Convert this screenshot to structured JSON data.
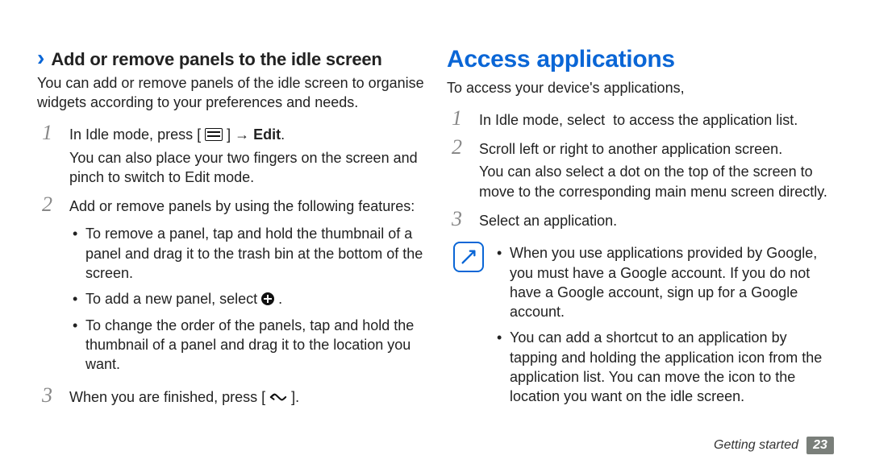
{
  "left": {
    "heading": "Add or remove panels to the idle screen",
    "intro": "You can add or remove panels of the idle screen to organise widgets according to your preferences and needs.",
    "step1_a": "In Idle mode, press [",
    "step1_b": "] → ",
    "step1_bold": "Edit",
    "step1_c": ".",
    "step1_sub": "You can also place your two fingers on the screen and pinch to switch to Edit mode.",
    "step2": "Add or remove panels by using the following features:",
    "b1": "To remove a panel, tap and hold the thumbnail of a panel and drag it to the trash bin at the bottom of the screen.",
    "b2_a": "To add a new panel, select ",
    "b2_b": ".",
    "b3": "To change the order of the panels, tap and hold the thumbnail of a panel and drag it to the location you want.",
    "step3_a": "When you are finished, press [",
    "step3_b": "]."
  },
  "right": {
    "heading": "Access applications",
    "intro": "To access your device's applications,",
    "step1_a": "In Idle mode, select ",
    "step1_b": " to access the application list.",
    "step2": "Scroll left or right to another application screen.",
    "step2_sub": "You can also select a dot on the top of the screen to move to the corresponding main menu screen directly.",
    "step3": "Select an application.",
    "note1": "When you use applications provided by Google, you must have a Google account. If you do not have a Google account, sign up for a Google account.",
    "note2": "You can add a shortcut to an application by tapping and holding the application icon from the application list. You can move the icon to the location you want on the idle screen."
  },
  "footer": {
    "section": "Getting started",
    "page": "23"
  }
}
